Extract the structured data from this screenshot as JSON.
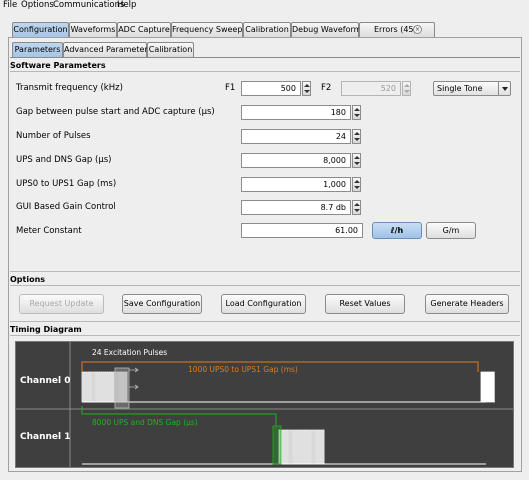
{
  "menu": {
    "file": "File",
    "options": "Options",
    "communications": "Communications",
    "help": "Help"
  },
  "main_tabs": [
    {
      "label": "Configuration",
      "active": true
    },
    {
      "label": "Waveforms",
      "active": false
    },
    {
      "label": "ADC Capture",
      "active": false
    },
    {
      "label": "Frequency Sweep",
      "active": false
    },
    {
      "label": "Calibration",
      "active": false
    },
    {
      "label": "Debug Waveform",
      "active": false
    },
    {
      "label": "Errors (45)",
      "active": false
    }
  ],
  "sub_tabs": [
    {
      "label": "Parameters",
      "active": true
    },
    {
      "label": "Advanced Parameters",
      "active": false
    },
    {
      "label": "Calibration",
      "active": false
    }
  ],
  "software_parameters": {
    "title": "Software Parameters",
    "transmit_frequency_label": "Transmit frequency (kHz)",
    "f1_label": "F1",
    "f1_value": "500",
    "f2_label": "F2",
    "f2_value": "520",
    "tone_mode": "Single Tone",
    "gap_adc_label": "Gap between pulse start and ADC capture (µs)",
    "gap_adc_value": "180",
    "num_pulses_label": "Number of Pulses",
    "num_pulses_value": "24",
    "ups_dns_label": "UPS and DNS Gap (µs)",
    "ups_dns_value": "8,000",
    "ups0_ups1_label": "UPS0 to UPS1 Gap (ms)",
    "ups0_ups1_value": "1,000",
    "gain_label": "GUI Based Gain Control",
    "gain_value": "8.7 db",
    "meter_label": "Meter Constant",
    "meter_value": "61.00",
    "unit_lh": "ℓ/h",
    "unit_gm": "G/m"
  },
  "options": {
    "title": "Options",
    "request_update": "Request Update",
    "save_configuration": "Save Configuration",
    "load_configuration": "Load Configuration",
    "reset_values": "Reset Values",
    "generate_headers": "Generate Headers"
  },
  "timing": {
    "title": "Timing Diagram",
    "channel0": "Channel 0",
    "channel1": "Channel 1",
    "excitation_label": "24 Excitation Pulses",
    "ups0_ups1_label": "1000 UPS0 to UPS1 Gap (ms)",
    "ups_dns_label": "8000 UPS and DNS Gap (µs)",
    "pulse_count": 24,
    "colors": {
      "background": "#3f3f3f",
      "pulse": "#ffffff",
      "ups0_ups1": "#e07b1a",
      "ups_dns": "#22b022"
    }
  }
}
